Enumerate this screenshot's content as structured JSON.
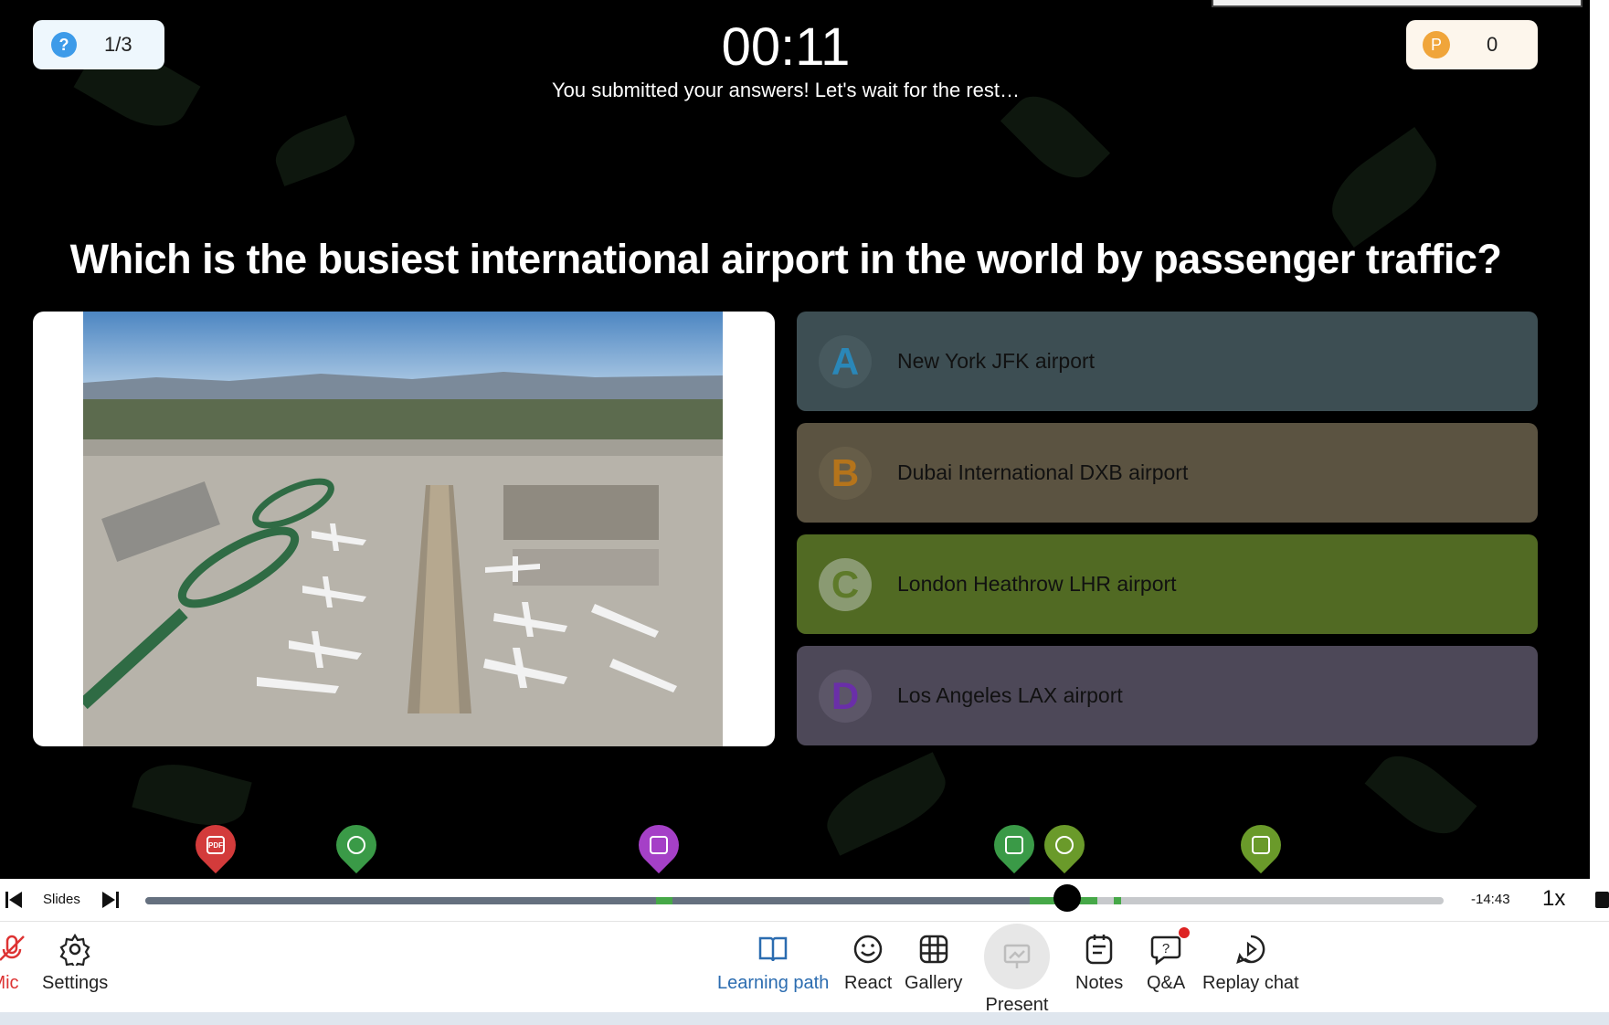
{
  "header": {
    "question_progress": "1/3",
    "progress_icon": "?",
    "timer": "00:11",
    "status_message": "You submitted your answers! Let's wait for the rest…",
    "points_icon": "P",
    "points": "0"
  },
  "question": {
    "text": "Which is the busiest international airport in the world by passenger traffic?",
    "image": "aerial-airport-photo"
  },
  "answers": [
    {
      "letter": "A",
      "text": "New York JFK airport",
      "bg": "#3d4e53",
      "letter_color": "#2a87b8",
      "circle": "#47595e"
    },
    {
      "letter": "B",
      "text": "Dubai International DXB airport",
      "bg": "#5b5341",
      "letter_color": "#b5741b",
      "circle": "#665d48"
    },
    {
      "letter": "C",
      "text": "London Heathrow LHR airport",
      "bg": "#516a23",
      "letter_color": "#5e7a2a",
      "circle": "#8a9a72"
    },
    {
      "letter": "D",
      "text": "Los Angeles LAX airport",
      "bg": "#4d4858",
      "letter_color": "#6a2fa8",
      "circle": "#5c5668"
    }
  ],
  "timeline_markers": [
    {
      "name": "pdf",
      "color": "#d33b3b",
      "label": "PDF"
    },
    {
      "name": "poll",
      "color": "#3a9a47",
      "label": ""
    },
    {
      "name": "image",
      "color": "#a540c7",
      "label": ""
    },
    {
      "name": "quiz",
      "color": "#3a9a47",
      "label": ""
    },
    {
      "name": "award",
      "color": "#6a9a2a",
      "label": ""
    },
    {
      "name": "chart",
      "color": "#6a9a2a",
      "label": ""
    }
  ],
  "player": {
    "slides_label": "Slides",
    "time_remaining": "-14:43",
    "speed": "1x",
    "progress": 0.71
  },
  "toolbar": {
    "mic": "Mic",
    "settings": "Settings",
    "learning_path": "Learning path",
    "react": "React",
    "gallery": "Gallery",
    "present": "Present",
    "notes": "Notes",
    "qa": "Q&A",
    "replay_chat": "Replay chat",
    "accent": "#2b6cb0"
  }
}
